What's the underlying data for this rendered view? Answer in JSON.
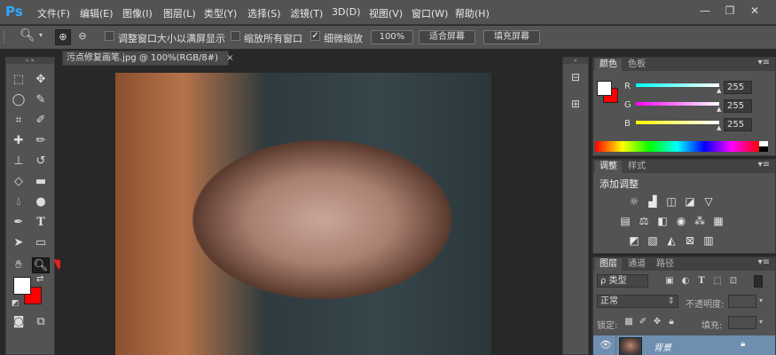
{
  "app": {
    "logo": "Ps"
  },
  "menu": [
    "文件(F)",
    "编辑(E)",
    "图像(I)",
    "图层(L)",
    "类型(Y)",
    "选择(S)",
    "滤镜(T)",
    "3D(D)",
    "视图(V)",
    "窗口(W)",
    "帮助(H)"
  ],
  "window_controls": {
    "minimize": "—",
    "restore": "❐",
    "close": "✕"
  },
  "options": {
    "resize_windows_label": "调整窗口大小以满屏显示",
    "zoom_all_label": "缩放所有窗口",
    "scrubby_zoom_label": "细微缩放",
    "scrubby_zoom_checked": true,
    "btn_100": "100%",
    "btn_fit": "适合屏幕",
    "btn_fill": "填充屏幕"
  },
  "document": {
    "tab_title": "污点修复画笔.jpg @ 100%(RGB/8#)",
    "tab_close": "×"
  },
  "color_panel": {
    "tab_active": "颜色",
    "tab_inactive": "色板",
    "channels": [
      {
        "label": "R",
        "value": "255"
      },
      {
        "label": "G",
        "value": "255"
      },
      {
        "label": "B",
        "value": "255"
      }
    ],
    "foreground": "#ffffff",
    "background": "#ff0000"
  },
  "adjust_panel": {
    "tab_active": "调整",
    "tab_inactive": "样式",
    "heading": "添加调整"
  },
  "layers_panel": {
    "tabs": [
      "图层",
      "通道",
      "路径"
    ],
    "kind_filter": "ρ 类型",
    "blend_mode": "正常",
    "opacity_label": "不透明度:",
    "lock_label": "锁定:",
    "fill_label": "填充:",
    "layer_name": "背景"
  },
  "colors": {
    "accent_blue": "#31a8ff",
    "arrow_red": "#e02020"
  }
}
